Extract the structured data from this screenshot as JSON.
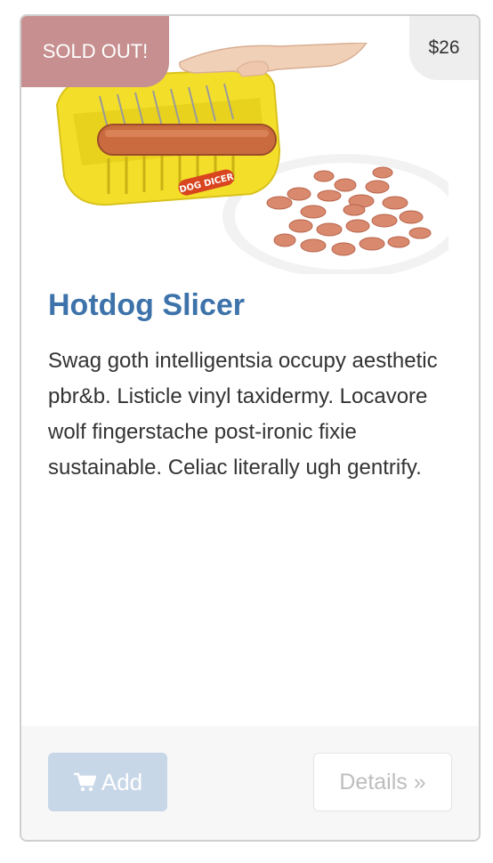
{
  "product": {
    "badge": "SOLD OUT!",
    "price": "$26",
    "title": "Hotdog Slicer",
    "description": "Swag goth intelligentsia occupy aesthetic pbr&b. Listicle vinyl taxidermy. Locavore wolf fingerstache post-ironic fixie sustainable. Celiac literally ugh gentrify.",
    "image_label": "DOG DICER"
  },
  "actions": {
    "add_label": "Add",
    "add_icon": "shopping-cart-icon",
    "details_label": "Details »"
  },
  "colors": {
    "sold_badge": "#c78f8f",
    "title": "#3d73aa",
    "add_button": "#c8d7e8"
  }
}
